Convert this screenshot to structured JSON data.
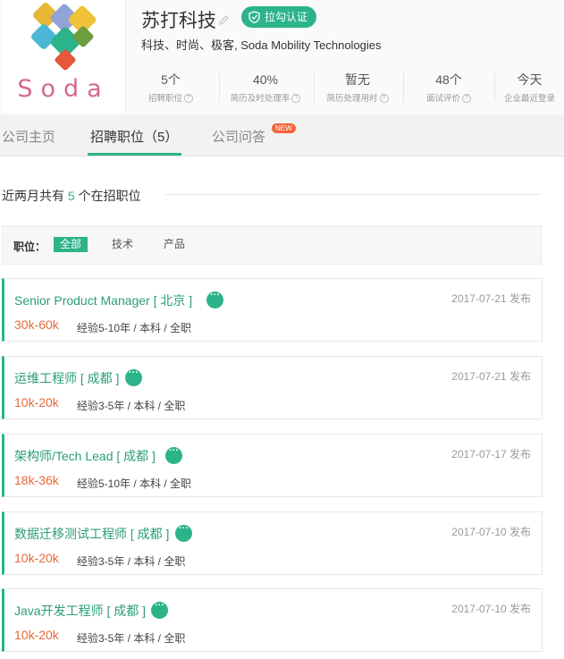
{
  "company": {
    "name": "苏打科技",
    "verify_label": "拉勾认证",
    "tagline": "科技、时尚、极客, Soda Mobility Technologies",
    "logo_text": "Soda",
    "brand_color": "#2cb38a"
  },
  "stats": [
    {
      "value": "5个",
      "label": "招聘职位"
    },
    {
      "value": "40%",
      "label": "简历及时处理率"
    },
    {
      "value": "暂无",
      "label": "简历处理用时"
    },
    {
      "value": "48个",
      "label": "面试评价"
    },
    {
      "value": "今天",
      "label": "企业最近登录"
    }
  ],
  "tabs": [
    {
      "label": "公司主页"
    },
    {
      "label": "招聘职位（5）"
    },
    {
      "label": "公司问答"
    }
  ],
  "new_badge": "NEW",
  "section": {
    "prefix": "近两月共有",
    "count": "5",
    "suffix": "个在招职位"
  },
  "filter": {
    "label": "职位：",
    "options": [
      "全部",
      "技术",
      "产品"
    ]
  },
  "jobs": [
    {
      "title": "Senior Product Manager [ 北京 ]",
      "date": "2017-07-21 发布",
      "salary": "30k-60k",
      "req": "经验5-10年 / 本科 / 全职"
    },
    {
      "title": "运维工程师 [ 成都 ]",
      "date": "2017-07-21 发布",
      "salary": "10k-20k",
      "req": "经验3-5年 / 本科 / 全职"
    },
    {
      "title": "架构师/Tech Lead [ 成都 ]",
      "date": "2017-07-17 发布",
      "salary": "18k-36k",
      "req": "经验5-10年 / 本科 / 全职"
    },
    {
      "title": "数据迁移测试工程师 [ 成都 ]",
      "date": "2017-07-10 发布",
      "salary": "10k-20k",
      "req": "经验3-5年 / 本科 / 全职"
    },
    {
      "title": "Java开发工程师 [ 成都 ]",
      "date": "2017-07-10 发布",
      "salary": "10k-20k",
      "req": "经验3-5年 / 本科 / 全职"
    }
  ]
}
